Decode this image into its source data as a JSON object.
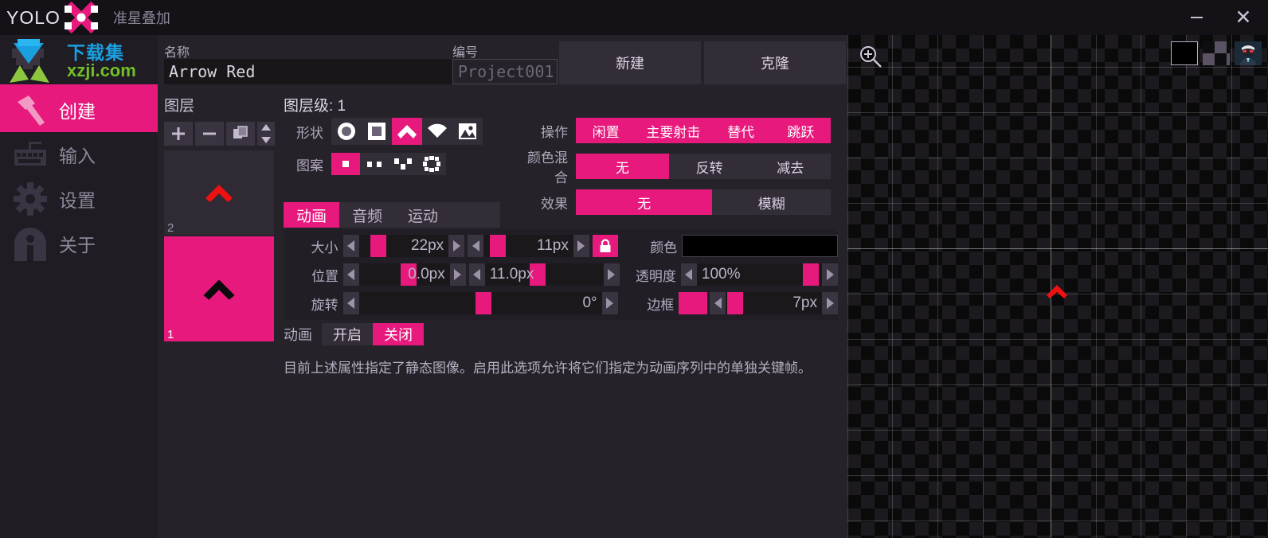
{
  "titlebar": {
    "brand": "YOLO",
    "subtitle": "准星叠加",
    "minimize_label": "–",
    "close_label": "✕"
  },
  "watermark": {
    "cn": "下载集",
    "en": "xzji.com"
  },
  "sidebar": {
    "items": [
      {
        "label": "创建",
        "icon": "hammer-icon",
        "active": true
      },
      {
        "label": "输入",
        "icon": "keyboard-icon",
        "active": false
      },
      {
        "label": "设置",
        "icon": "gear-icon",
        "active": false
      },
      {
        "label": "关于",
        "icon": "info-icon",
        "active": false
      }
    ]
  },
  "topform": {
    "name_label": "名称",
    "name_value": "Arrow Red",
    "id_label": "编号",
    "id_placeholder": "Project001",
    "new_button": "新建",
    "clone_button": "克隆"
  },
  "layers": {
    "title": "图层",
    "level_label": "图层级: 1",
    "add_label": "+",
    "remove_label": "−",
    "duplicate_label": "copy-icon",
    "reorder_label": "updown-icon",
    "items": [
      {
        "num": "2",
        "selected": false,
        "chevron_color": "#ee1111",
        "bg": "#2f2a33",
        "num_color": "#9c93a6"
      },
      {
        "num": "1",
        "selected": true,
        "chevron_color": "#0b0b0b",
        "bg": "#e8197d",
        "num_color": "#ffffff"
      }
    ]
  },
  "shape": {
    "label": "形状",
    "options": [
      {
        "icon": "circle-icon",
        "on": false
      },
      {
        "icon": "square-icon",
        "on": false
      },
      {
        "icon": "chevron-icon",
        "on": true
      },
      {
        "icon": "wifi-arc-icon",
        "on": false
      },
      {
        "icon": "image-icon",
        "on": false
      }
    ]
  },
  "pattern": {
    "label": "图案",
    "options": [
      {
        "icon": "solid-dot-icon",
        "on": true
      },
      {
        "icon": "two-dots-icon",
        "on": false
      },
      {
        "icon": "three-dots-icon",
        "on": false
      },
      {
        "icon": "ring-dots-icon",
        "on": false
      }
    ]
  },
  "action": {
    "label": "操作",
    "options": [
      {
        "label": "闲置",
        "on": true
      },
      {
        "label": "主要射击",
        "on": true
      },
      {
        "label": "替代",
        "on": true
      },
      {
        "label": "跳跃",
        "on": true
      }
    ]
  },
  "blend": {
    "label": "颜色混合",
    "options": [
      {
        "label": "无",
        "on": true
      },
      {
        "label": "反转",
        "on": false
      },
      {
        "label": "减去",
        "on": false
      }
    ]
  },
  "effect": {
    "label": "效果",
    "options": [
      {
        "label": "无",
        "on": true
      },
      {
        "label": "模糊",
        "on": false
      }
    ]
  },
  "tabs": [
    {
      "label": "动画",
      "on": true
    },
    {
      "label": "音频",
      "on": false
    },
    {
      "label": "运动",
      "on": false
    }
  ],
  "controls": {
    "size": {
      "label": "大小",
      "width_value": "22px",
      "height_value": "11px",
      "lock_icon": "lock-icon",
      "locked": true
    },
    "position": {
      "label": "位置",
      "x_value": "0.0px",
      "y_value": "11.0px"
    },
    "rotation": {
      "label": "旋转",
      "value": "0°"
    },
    "color": {
      "label": "颜色",
      "value": "#000000"
    },
    "opacity": {
      "label": "透明度",
      "value": "100%"
    },
    "outline": {
      "label": "边框",
      "swatch": "#e8197d",
      "value": "7px"
    }
  },
  "animation": {
    "label": "动画",
    "on_label": "开启",
    "off_label": "关闭",
    "selected": "关闭",
    "description": "目前上述属性指定了静态图像。启用此选项允许将它们指定为动画序列中的单独关键帧。"
  },
  "preview": {
    "zoom_icon": "zoom-in-icon",
    "backgrounds": [
      {
        "name": "black-background",
        "selected": true
      },
      {
        "name": "checker-background",
        "selected": false
      },
      {
        "name": "character-background",
        "selected": false
      }
    ],
    "crosshair_color": "#ee1111"
  },
  "theme": {
    "accent": "#e8197d",
    "panel": "#262229",
    "dark": "#1d1a20"
  }
}
